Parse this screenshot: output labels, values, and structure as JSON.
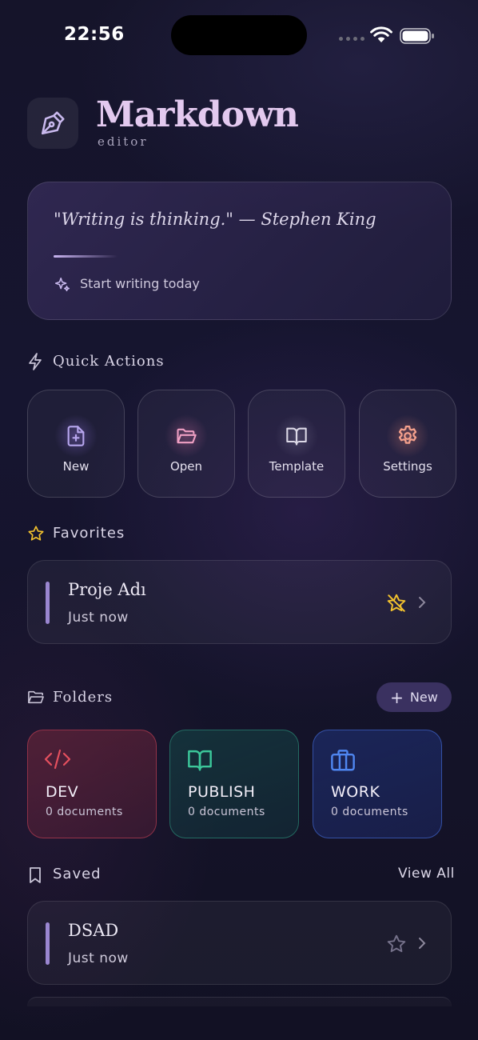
{
  "status_bar": {
    "time": "22:56"
  },
  "header": {
    "title": "Markdown",
    "subtitle": "editor"
  },
  "quote_card": {
    "quote": "\"Writing is thinking.\" — Stephen King",
    "cta": "Start writing today"
  },
  "quick_actions": {
    "heading": "Quick Actions",
    "items": [
      {
        "label": "New",
        "icon": "file-plus-icon",
        "color": "#b7a6ee"
      },
      {
        "label": "Open",
        "icon": "folder-open-icon",
        "color": "#f0a0c4"
      },
      {
        "label": "Template",
        "icon": "book-open-icon",
        "color": "#dcd8e6"
      },
      {
        "label": "Settings",
        "icon": "gear-icon",
        "color": "#f4a08c"
      }
    ]
  },
  "favorites": {
    "heading": "Favorites",
    "items": [
      {
        "title": "Proje Adı",
        "time": "Just now",
        "icon": "star-off-icon"
      }
    ]
  },
  "folders": {
    "heading": "Folders",
    "new_label": "New",
    "items": [
      {
        "name": "DEV",
        "count": "0 documents",
        "icon": "code-icon",
        "color": "#e4505e"
      },
      {
        "name": "PUBLISH",
        "count": "0 documents",
        "icon": "book-open-icon",
        "color": "#3cc79a"
      },
      {
        "name": "WORK",
        "count": "0 documents",
        "icon": "briefcase-icon",
        "color": "#4f86f0"
      }
    ]
  },
  "saved": {
    "heading": "Saved",
    "view_all": "View All",
    "items": [
      {
        "title": "DSAD",
        "time": "Just now",
        "icon": "star-icon"
      }
    ]
  },
  "colors": {
    "accent": "#9a86d0",
    "favorite_star": "#f2c12e"
  }
}
